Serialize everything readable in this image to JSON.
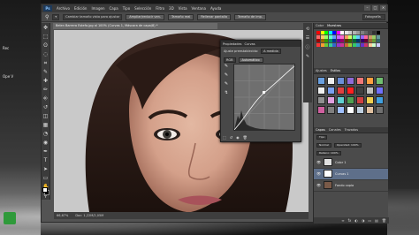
{
  "desktop": {
    "left_labels": [
      "Rec",
      "Ope V"
    ],
    "right_labels": [
      "r",
      "o"
    ]
  },
  "app": {
    "logo": "Ps",
    "menu": [
      "Archivo",
      "Edición",
      "Imagen",
      "Capa",
      "Tipo",
      "Selección",
      "Filtro",
      "3D",
      "Vista",
      "Ventana",
      "Ayuda"
    ],
    "window_buttons": [
      "–",
      "□",
      "✕"
    ]
  },
  "options": {
    "tool_preset": "▾",
    "sample_label": "Cambiar tamaño de muestra",
    "sample_value": "Cambiar tamaño vista para ajustar",
    "btn_actual": "Ampliar/reducir ven.",
    "btn_all": "Todas las ventanas",
    "btn_fit": "Tamaño real",
    "btn_fill": "Rellenar pantalla",
    "btn_fit2": "Tamaño de imp.",
    "workspace": "Fotografía"
  },
  "tools": {
    "icons": [
      "move-icon",
      "marquee-icon",
      "lasso-icon",
      "quick-select-icon",
      "crop-icon",
      "eyedropper-icon",
      "heal-icon",
      "brush-icon",
      "stamp-icon",
      "history-brush-icon",
      "eraser-icon",
      "gradient-icon",
      "blur-icon",
      "dodge-icon",
      "pen-icon",
      "type-icon",
      "path-select-icon",
      "shape-icon",
      "hand-icon",
      "zoom-icon"
    ],
    "glyphs": [
      "✥",
      "⬚",
      "ʘ",
      "◌",
      "⌗",
      "✎",
      "✚",
      "✏",
      "⎆",
      "↺",
      "◫",
      "▦",
      "◔",
      "◉",
      "✒",
      "T",
      "➤",
      "▭",
      "✋",
      "⚲"
    ]
  },
  "document": {
    "tab": "Belen Barrera Estefa.jpg al 100% (Curvas 1, Máscara de capa/8) *",
    "zoom": "66,67%",
    "doc_size": "Doc: 1,22M/2,05M"
  },
  "curves": {
    "tab1": "Propiedades",
    "tab2": "Curvas",
    "preset_label": "Ajuste preestablecido:",
    "preset_value": "A medida",
    "channel_value": "RGB",
    "auto_label": "Automático",
    "side_icons": [
      "✎",
      "✎",
      "✎",
      "↯"
    ],
    "foot_icons": [
      "⬚",
      "↺",
      "◉",
      "🗑"
    ]
  },
  "swatches": {
    "tabs": [
      "Color",
      "Muestras"
    ],
    "colors": [
      "#ff0000",
      "#ffff00",
      "#00ff00",
      "#00ffff",
      "#0000ff",
      "#ff00ff",
      "#ffffff",
      "#e6e6e6",
      "#cccccc",
      "#b3b3b3",
      "#999999",
      "#808080",
      "#666666",
      "#4d4d4d",
      "#333333",
      "#000000",
      "#ff6666",
      "#ffcc66",
      "#99ff66",
      "#66ffcc",
      "#6699ff",
      "#cc66ff",
      "#ff66cc",
      "#ff9966",
      "#ccff66",
      "#66ff99",
      "#66ccff",
      "#9966ff",
      "#ff6699",
      "#cc9966",
      "#99cc66",
      "#669999",
      "#990000",
      "#996600",
      "#339900",
      "#009966",
      "#003399",
      "#660099",
      "#990066",
      "#663300",
      "#336600",
      "#006633",
      "#003366",
      "#330066",
      "#660033",
      "#996633",
      "#669933",
      "#336666",
      "#ff3333",
      "#ff9933",
      "#66cc33",
      "#33cc99",
      "#3366cc",
      "#9933cc",
      "#cc3399",
      "#cc6633",
      "#99cc33",
      "#33cc66",
      "#3399cc",
      "#6633cc",
      "#cc3366",
      "#ffcc99",
      "#ccffcc",
      "#ccccff"
    ]
  },
  "styles": {
    "tabs": [
      "Ajustes",
      "Estilos"
    ],
    "colors": [
      "#6aa0e0",
      "#f0f0f0",
      "#6b8fd8",
      "#8f6bd8",
      "#f07878",
      "#ffa040",
      "#70c070",
      "#f0f0f0",
      "#7aa0f0",
      "#e04040",
      "#ff2020",
      "#404040",
      "#c0c0c0",
      "#7070ff",
      "#909090",
      "#e0a0e0",
      "#60d0d0",
      "#50a050",
      "#d04040",
      "#f0d050",
      "#40a0e0",
      "#d060a0",
      "#808080",
      "#a0c0ff",
      "#ffffff",
      "#c0d0e0",
      "#e0c0a0",
      "#707070"
    ]
  },
  "layers": {
    "tabs": [
      "Capas",
      "Canales",
      "Trazados"
    ],
    "kind_label": "Tipo",
    "blend_mode": "Normal",
    "opacity_label": "Opacidad: 100%",
    "fill_label": "Relleno: 100%",
    "rows": [
      {
        "name": "Color 1",
        "thumb": "#e0e0e0"
      },
      {
        "name": "Curvas 1",
        "thumb": "#ffffff"
      },
      {
        "name": "Fondo copia",
        "thumb": "#7a5a48"
      }
    ],
    "footer": [
      "∞",
      "fx",
      "◐",
      "◑",
      "▭",
      "▤",
      "🗑"
    ]
  }
}
